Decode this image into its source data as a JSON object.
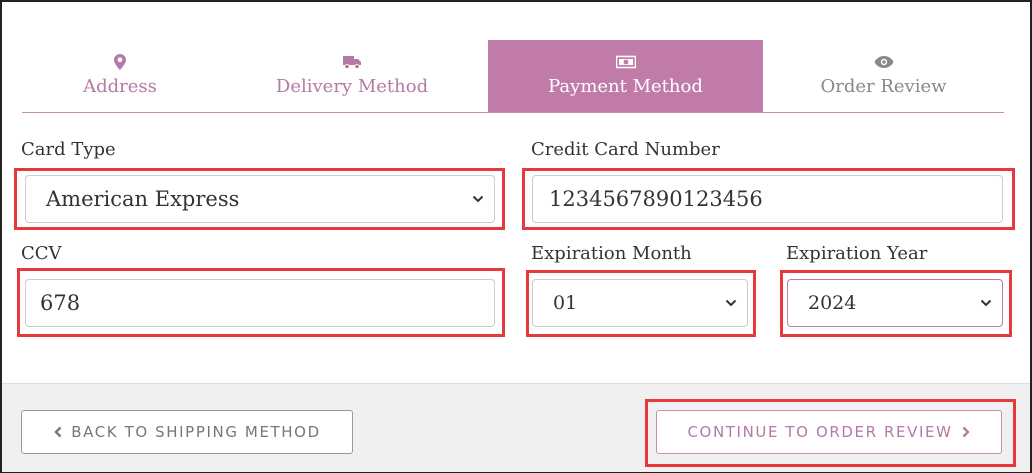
{
  "tabs": {
    "address": {
      "label": "Address",
      "icon": "map-marker-icon"
    },
    "delivery": {
      "label": "Delivery Method",
      "icon": "truck-icon"
    },
    "payment": {
      "label": "Payment Method",
      "icon": "money-bill-icon"
    },
    "review": {
      "label": "Order Review",
      "icon": "eye-icon"
    }
  },
  "form": {
    "card_type": {
      "label": "Card Type",
      "value": "American Express"
    },
    "card_number": {
      "label": "Credit Card Number",
      "value": "1234567890123456"
    },
    "ccv": {
      "label": "CCV",
      "value": "678"
    },
    "exp_month": {
      "label": "Expiration Month",
      "value": "01"
    },
    "exp_year": {
      "label": "Expiration Year",
      "value": "2024"
    }
  },
  "buttons": {
    "back": "BACK TO SHIPPING METHOD",
    "continue": "CONTINUE TO ORDER REVIEW"
  },
  "colors": {
    "accent": "#c17ba9",
    "accent_text": "#b479a6",
    "highlight": "#e5393c"
  }
}
